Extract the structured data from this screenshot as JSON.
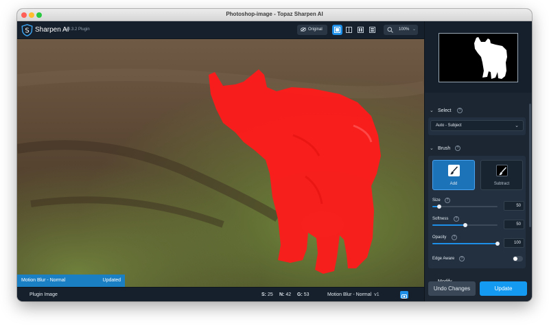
{
  "window": {
    "title": "Photoshop-image - Topaz Sharpen AI"
  },
  "toolbar": {
    "app_name": "Sharpen AI",
    "app_version": "v3.3.2 Plugin",
    "original_label": "Original",
    "zoom": "100%"
  },
  "canvas": {
    "status_mode": "Motion Blur - Normal",
    "status_state": "Updated"
  },
  "bottombar": {
    "plugin_label": "Plugin Image",
    "s_label": "S:",
    "s_value": "25",
    "n_label": "N:",
    "n_value": "42",
    "g_label": "G:",
    "g_value": "53",
    "model": "Motion Blur - Normal",
    "model_version": "v1"
  },
  "panel": {
    "select": {
      "title": "Select",
      "help": "?",
      "mode": "Auto - Subject"
    },
    "brush": {
      "title": "Brush",
      "help": "?",
      "add_label": "Add",
      "subtract_label": "Subtract",
      "size": {
        "label": "Size",
        "value": "50",
        "level": 0.1
      },
      "softness": {
        "label": "Softness",
        "value": "50",
        "level": 0.5
      },
      "opacity": {
        "label": "Opacity",
        "value": "100",
        "level": 1.0
      },
      "edge_aware": {
        "label": "Edge Aware",
        "enabled": false
      }
    },
    "modify": {
      "title": "Modify"
    },
    "undo_label": "Undo Changes",
    "update_label": "Update"
  },
  "colors": {
    "accent": "#1d8fe8",
    "mask_overlay": "#ff1a1a",
    "panel_bg": "#1b2632"
  }
}
